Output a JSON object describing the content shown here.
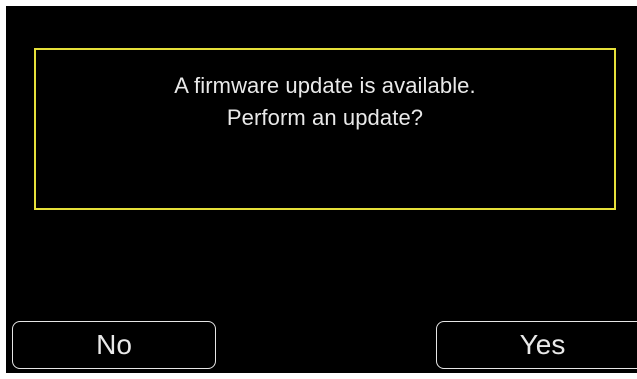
{
  "dialog": {
    "message_line1": "A firmware update is available.",
    "message_line2": "Perform an update?",
    "border_color": "#e6e03a"
  },
  "buttons": {
    "no_label": "No",
    "yes_label": "Yes"
  }
}
